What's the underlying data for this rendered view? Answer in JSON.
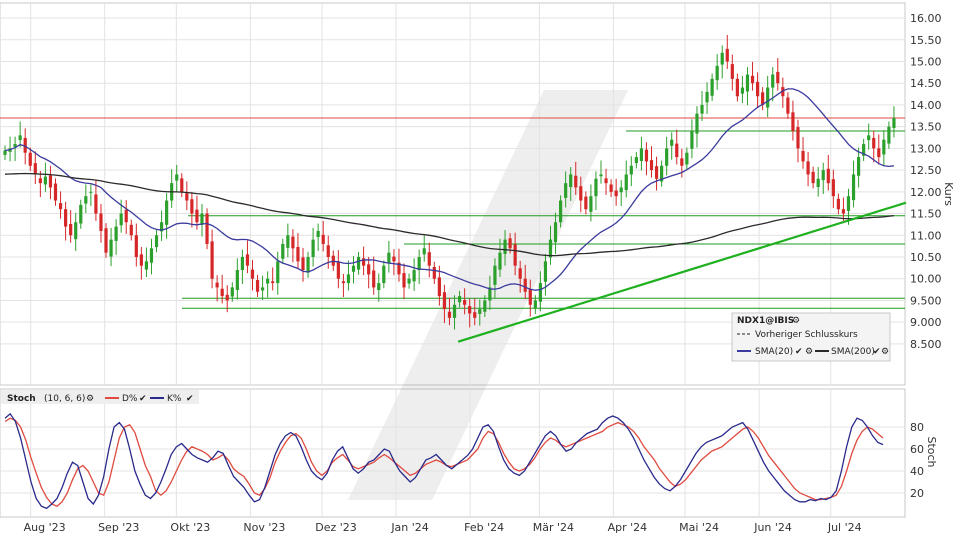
{
  "colors": {
    "up": "#2ca02c",
    "down": "#d62728",
    "sma20": "#3b3b9e",
    "sma200": "#2b2b2b",
    "resistance": "#e04a3f",
    "support": "#1f9a1f",
    "trend": "#1fb01f",
    "stoch_d": "#e04a3f",
    "stoch_k": "#2a2a8c",
    "grid": "#e3e3e3"
  },
  "chart_data": [
    {
      "type": "line",
      "subtype": "candlestick",
      "ylabel": "Kurs",
      "ylim": [
        7.6,
        16.3
      ],
      "yticks": [
        "8.500",
        "9.000",
        "9.500",
        "10.00",
        "10.50",
        "11.00",
        "11.50",
        "12.00",
        "12.50",
        "13.00",
        "13.50",
        "14.00",
        "14.50",
        "15.00",
        "15.50",
        "16.00"
      ],
      "ytick_values": [
        8.5,
        9.0,
        9.5,
        10.0,
        10.5,
        11.0,
        11.5,
        12.0,
        12.5,
        13.0,
        13.5,
        14.0,
        14.5,
        15.0,
        15.5,
        16.0
      ],
      "xticks": [
        "Aug '23",
        "Sep '23",
        "Okt '23",
        "Nov '23",
        "Dez '23",
        "Jan '24",
        "Feb '24",
        "Mär '24",
        "Apr '24",
        "Mai '24",
        "Jun '24",
        "Jul '24"
      ],
      "x_start": "2023-07-20",
      "x_end": "2024-07-30",
      "close": [
        12.95,
        13.0,
        13.1,
        13.3,
        12.9,
        12.6,
        12.4,
        12.2,
        12.35,
        12.1,
        11.8,
        11.6,
        11.2,
        11.0,
        11.3,
        11.7,
        11.9,
        12.0,
        11.5,
        11.1,
        10.6,
        10.9,
        11.2,
        11.5,
        11.3,
        11.0,
        10.5,
        10.3,
        10.4,
        10.7,
        11.0,
        11.3,
        11.8,
        12.2,
        12.4,
        12.0,
        11.8,
        11.5,
        11.3,
        11.5,
        10.8,
        10.0,
        9.8,
        9.6,
        9.5,
        9.8,
        10.2,
        10.5,
        10.3,
        10.0,
        9.7,
        9.8,
        10.0,
        9.9,
        10.4,
        10.8,
        11.0,
        10.7,
        10.4,
        10.2,
        10.5,
        10.9,
        11.1,
        10.8,
        10.5,
        10.3,
        10.0,
        9.9,
        10.1,
        10.3,
        10.5,
        10.3,
        10.1,
        9.8,
        9.9,
        10.3,
        10.6,
        10.4,
        10.1,
        9.8,
        10.0,
        10.2,
        10.5,
        10.7,
        10.3,
        10.0,
        9.6,
        9.3,
        9.1,
        9.4,
        9.6,
        9.4,
        9.2,
        9.1,
        9.3,
        9.5,
        9.8,
        10.3,
        10.6,
        10.9,
        10.7,
        10.3,
        10.0,
        9.7,
        9.4,
        9.5,
        9.9,
        10.4,
        10.9,
        11.3,
        11.8,
        12.2,
        12.4,
        12.1,
        11.8,
        11.6,
        11.9,
        12.3,
        12.4,
        12.2,
        12.0,
        11.9,
        12.1,
        12.4,
        12.6,
        12.8,
        13.0,
        12.7,
        12.5,
        12.3,
        12.6,
        13.0,
        13.2,
        12.8,
        12.6,
        12.9,
        13.4,
        13.8,
        14.0,
        14.3,
        14.6,
        14.9,
        15.2,
        15.0,
        14.6,
        14.2,
        14.4,
        14.7,
        14.5,
        14.2,
        14.0,
        14.4,
        14.7,
        14.5,
        14.2,
        13.8,
        13.4,
        13.0,
        12.7,
        12.4,
        12.2,
        12.3,
        12.5,
        12.2,
        11.9,
        11.6,
        11.5,
        11.9,
        12.4,
        12.8,
        13.1,
        13.3,
        13.0,
        12.8,
        13.2,
        13.5,
        13.7
      ],
      "sma20_end": 12.6,
      "sma200_end": 11.45,
      "horizontal_lines": [
        13.7,
        13.4,
        11.45,
        10.8,
        9.55,
        9.32
      ],
      "trendline": {
        "from": [
          "2024-01-27",
          8.55
        ],
        "to": [
          "2024-07-30",
          11.75
        ]
      },
      "legend": {
        "symbol": "NDX1@IBIS",
        "prev_close": "Vorheriger Schlusskurs",
        "sma20": "SMA(20)",
        "sma200": "SMA(200)"
      }
    },
    {
      "type": "line",
      "title": "Stoch",
      "params": "(10, 6, 6)",
      "ylabel": "Stoch",
      "ylim": [
        0,
        100
      ],
      "yticks": [
        "20",
        "40",
        "60",
        "80"
      ],
      "ytick_values": [
        20,
        40,
        60,
        80
      ],
      "series": [
        {
          "name": "D%",
          "values": [
            85,
            88,
            86,
            80,
            68,
            52,
            38,
            25,
            16,
            10,
            8,
            12,
            20,
            32,
            42,
            45,
            40,
            30,
            20,
            18,
            30,
            50,
            70,
            80,
            82,
            75,
            60,
            45,
            35,
            22,
            18,
            22,
            30,
            40,
            50,
            58,
            62,
            60,
            58,
            55,
            50,
            52,
            55,
            50,
            42,
            38,
            35,
            28,
            20,
            18,
            24,
            34,
            48,
            58,
            66,
            72,
            74,
            70,
            60,
            48,
            40,
            36,
            40,
            48,
            52,
            55,
            50,
            44,
            42,
            44,
            46,
            48,
            52,
            55,
            52,
            48,
            44,
            40,
            36,
            38,
            42,
            46,
            48,
            50,
            48,
            45,
            44,
            46,
            48,
            50,
            55,
            60,
            70,
            76,
            74,
            66,
            56,
            48,
            42,
            40,
            42,
            46,
            52,
            60,
            66,
            70,
            68,
            64,
            62,
            64,
            66,
            68,
            70,
            72,
            74,
            76,
            80,
            82,
            84,
            82,
            80,
            76,
            70,
            62,
            56,
            50,
            42,
            36,
            30,
            26,
            28,
            32,
            38,
            44,
            50,
            54,
            58,
            60,
            62,
            66,
            70,
            74,
            78,
            80,
            76,
            70,
            62,
            54,
            48,
            42,
            36,
            30,
            24,
            20,
            18,
            16,
            14,
            14,
            15,
            16,
            18,
            26,
            40,
            56,
            68,
            76,
            80,
            78,
            74,
            70
          ]
        },
        {
          "name": "K%",
          "values": [
            88,
            92,
            85,
            70,
            50,
            30,
            15,
            8,
            6,
            10,
            15,
            25,
            38,
            48,
            45,
            30,
            15,
            10,
            18,
            35,
            60,
            80,
            84,
            78,
            60,
            40,
            28,
            18,
            15,
            20,
            30,
            42,
            55,
            62,
            65,
            60,
            55,
            52,
            50,
            48,
            52,
            58,
            56,
            45,
            35,
            30,
            25,
            18,
            12,
            14,
            25,
            40,
            55,
            65,
            72,
            75,
            72,
            62,
            50,
            40,
            35,
            32,
            38,
            50,
            58,
            62,
            52,
            42,
            38,
            42,
            48,
            50,
            55,
            60,
            58,
            48,
            40,
            35,
            30,
            34,
            42,
            50,
            52,
            55,
            50,
            45,
            42,
            46,
            50,
            54,
            60,
            70,
            80,
            82,
            76,
            62,
            50,
            42,
            38,
            36,
            40,
            48,
            56,
            64,
            72,
            76,
            72,
            64,
            58,
            60,
            66,
            70,
            74,
            76,
            78,
            84,
            88,
            90,
            88,
            84,
            78,
            70,
            60,
            50,
            42,
            34,
            28,
            24,
            22,
            26,
            32,
            40,
            48,
            56,
            62,
            66,
            68,
            70,
            72,
            76,
            80,
            82,
            84,
            78,
            68,
            58,
            48,
            40,
            34,
            28,
            22,
            18,
            14,
            12,
            12,
            14,
            13,
            15,
            14,
            16,
            22,
            40,
            62,
            80,
            88,
            86,
            80,
            72,
            66,
            64
          ]
        }
      ]
    }
  ]
}
